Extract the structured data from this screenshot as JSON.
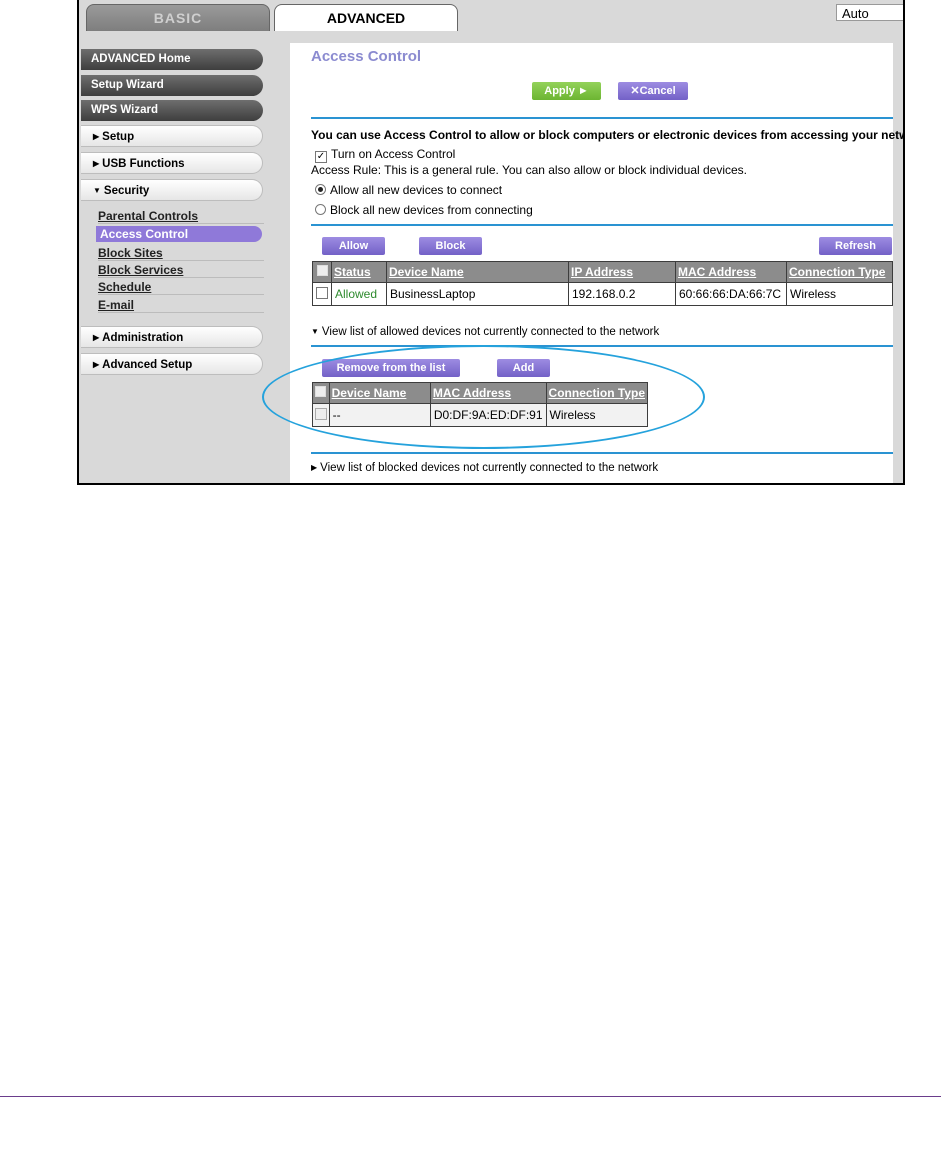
{
  "tabs": {
    "basic": "BASIC",
    "advanced": "ADVANCED"
  },
  "language_select": {
    "value": "Auto"
  },
  "menu": {
    "advanced_home": "ADVANCED Home",
    "setup_wizard": "Setup Wizard",
    "wps_wizard": "WPS Wizard",
    "setup": "Setup",
    "usb_functions": "USB Functions",
    "security": "Security",
    "security_items": [
      "Parental Controls",
      "Access Control",
      "Block Sites",
      "Block Services",
      "Schedule",
      "E-mail"
    ],
    "administration": "Administration",
    "advanced_setup": "Advanced Setup"
  },
  "page": {
    "title": "Access Control",
    "apply_label": "Apply ►",
    "cancel_label": "Cancel",
    "intro": "You can use Access Control to allow or block computers or electronic devices from accessing your network.",
    "turn_on_label": "Turn on Access Control",
    "turn_on_checked": true,
    "access_rule": "Access Rule: This is a general rule. You can also allow or block individual devices.",
    "radio_allow": "Allow all new devices to connect",
    "radio_block": "Block all new devices from connecting",
    "selected_rule": "allow"
  },
  "connected": {
    "allow_label": "Allow",
    "block_label": "Block",
    "refresh_label": "Refresh",
    "columns": [
      "Status",
      "Device Name",
      "IP Address",
      "MAC Address",
      "Connection Type"
    ],
    "rows": [
      {
        "status": "Allowed",
        "device": "BusinessLaptop",
        "ip": "192.168.0.2",
        "mac": "60:66:66:DA:66:7C",
        "type": "Wireless"
      }
    ]
  },
  "allowed_list": {
    "toggle_label": "View list of allowed devices not currently connected to the network",
    "remove_label": "Remove from the list",
    "add_label": "Add",
    "columns": [
      "Device Name",
      "MAC Address",
      "Connection Type"
    ],
    "rows": [
      {
        "device": "--",
        "mac": "D0:DF:9A:ED:DF:91",
        "type": "Wireless"
      }
    ]
  },
  "blocked_list": {
    "toggle_label": "View list of blocked devices not currently connected to the network"
  },
  "colors": {
    "accent_blue": "#2a93d2",
    "menu_purple": "#8f79d9",
    "allowed_green": "#2e8b2e",
    "highlight_oval": "#25a2dc"
  }
}
